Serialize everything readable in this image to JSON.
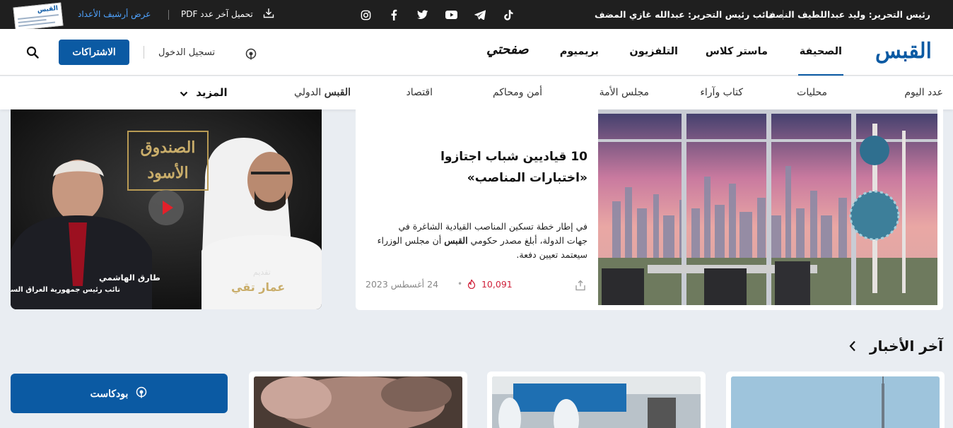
{
  "topbar": {
    "editor": "رئيس التحرير: وليد عبداللطيف النصف",
    "deputy": "نائب رئيس التحرير: عبدالله غازي المضف",
    "pdf_label": "تحميل آخر عدد PDF",
    "archive_label": "عرض أرشيف الأعداد",
    "thumb_logo": "القبس"
  },
  "header": {
    "logo": "القبس",
    "nav": [
      "الصحيفة",
      "ماستر كلاس",
      "التلفزيون",
      "بريميوم"
    ],
    "safhati": "صفحتي",
    "login": "تسجيل الدخول",
    "subscribe": "الاشتراكات"
  },
  "subnav": {
    "items": [
      "عدد اليوم",
      "محليات",
      "كتاب وآراء",
      "مجلس الأمة",
      "أمن ومحاكم",
      "اقتصاد"
    ],
    "intl_brand": "القبس",
    "intl_suffix": "الدولي",
    "more": "المزيد"
  },
  "feature": {
    "title": "10 قياديين شباب اجتازوا «اختبارات المناصب»",
    "summary_before": "في إطار خطة تسكين المناصب القيادية الشاغرة في جهات الدولة، أبلغ مصدر حكومي ",
    "summary_brand": "القبس",
    "summary_after": " أن مجلس الوزراء سيعتمد تعيين دفعة.",
    "views": "10,091",
    "date": "24 أغسطس 2023"
  },
  "video": {
    "show_title_1": "الصندوق",
    "show_title_2": "الأسود",
    "guest_name": "طارق الهاشمي",
    "guest_role": "نائب رئيس جمهورية العراق السابق",
    "host_label": "تقديم",
    "host_name": "عمار تقي"
  },
  "latest": {
    "title": "آخر الأخبار",
    "podcast": "بودكاست"
  },
  "colors": {
    "brand": "#0b5aa3",
    "views": "#d0213a",
    "topbar": "#1f1f1f"
  }
}
